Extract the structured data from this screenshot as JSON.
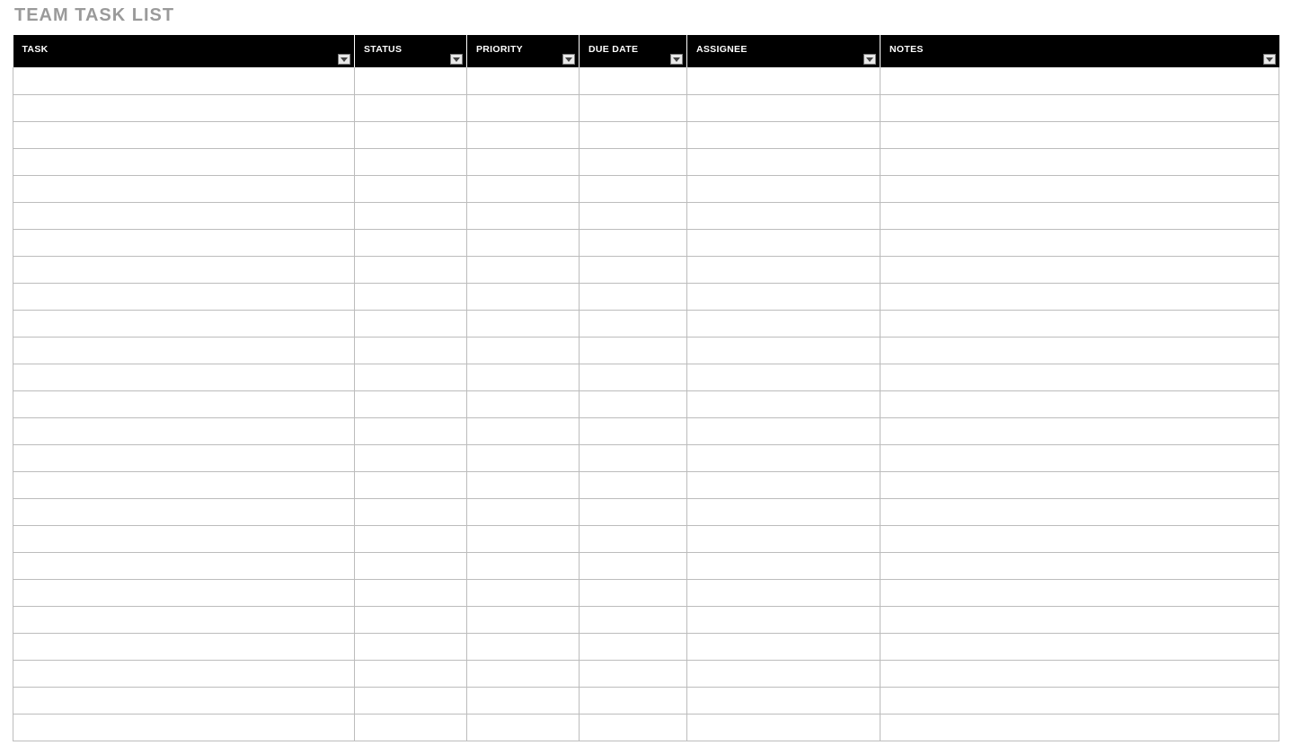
{
  "title": "TEAM TASK LIST",
  "columns": [
    {
      "key": "task",
      "label": "TASK",
      "filter": true
    },
    {
      "key": "status",
      "label": "STATUS",
      "filter": true
    },
    {
      "key": "priority",
      "label": "PRIORITY",
      "filter": true
    },
    {
      "key": "duedate",
      "label": "DUE DATE",
      "filter": true
    },
    {
      "key": "assignee",
      "label": "ASSIGNEE",
      "filter": true
    },
    {
      "key": "notes",
      "label": "NOTES",
      "filter": true
    }
  ],
  "rows": [
    {
      "task": "",
      "status": "",
      "priority": "",
      "duedate": "",
      "assignee": "",
      "notes": ""
    },
    {
      "task": "",
      "status": "",
      "priority": "",
      "duedate": "",
      "assignee": "",
      "notes": ""
    },
    {
      "task": "",
      "status": "",
      "priority": "",
      "duedate": "",
      "assignee": "",
      "notes": ""
    },
    {
      "task": "",
      "status": "",
      "priority": "",
      "duedate": "",
      "assignee": "",
      "notes": ""
    },
    {
      "task": "",
      "status": "",
      "priority": "",
      "duedate": "",
      "assignee": "",
      "notes": ""
    },
    {
      "task": "",
      "status": "",
      "priority": "",
      "duedate": "",
      "assignee": "",
      "notes": ""
    },
    {
      "task": "",
      "status": "",
      "priority": "",
      "duedate": "",
      "assignee": "",
      "notes": ""
    },
    {
      "task": "",
      "status": "",
      "priority": "",
      "duedate": "",
      "assignee": "",
      "notes": ""
    },
    {
      "task": "",
      "status": "",
      "priority": "",
      "duedate": "",
      "assignee": "",
      "notes": ""
    },
    {
      "task": "",
      "status": "",
      "priority": "",
      "duedate": "",
      "assignee": "",
      "notes": ""
    },
    {
      "task": "",
      "status": "",
      "priority": "",
      "duedate": "",
      "assignee": "",
      "notes": ""
    },
    {
      "task": "",
      "status": "",
      "priority": "",
      "duedate": "",
      "assignee": "",
      "notes": ""
    },
    {
      "task": "",
      "status": "",
      "priority": "",
      "duedate": "",
      "assignee": "",
      "notes": ""
    },
    {
      "task": "",
      "status": "",
      "priority": "",
      "duedate": "",
      "assignee": "",
      "notes": ""
    },
    {
      "task": "",
      "status": "",
      "priority": "",
      "duedate": "",
      "assignee": "",
      "notes": ""
    },
    {
      "task": "",
      "status": "",
      "priority": "",
      "duedate": "",
      "assignee": "",
      "notes": ""
    },
    {
      "task": "",
      "status": "",
      "priority": "",
      "duedate": "",
      "assignee": "",
      "notes": ""
    },
    {
      "task": "",
      "status": "",
      "priority": "",
      "duedate": "",
      "assignee": "",
      "notes": ""
    },
    {
      "task": "",
      "status": "",
      "priority": "",
      "duedate": "",
      "assignee": "",
      "notes": ""
    },
    {
      "task": "",
      "status": "",
      "priority": "",
      "duedate": "",
      "assignee": "",
      "notes": ""
    },
    {
      "task": "",
      "status": "",
      "priority": "",
      "duedate": "",
      "assignee": "",
      "notes": ""
    },
    {
      "task": "",
      "status": "",
      "priority": "",
      "duedate": "",
      "assignee": "",
      "notes": ""
    },
    {
      "task": "",
      "status": "",
      "priority": "",
      "duedate": "",
      "assignee": "",
      "notes": ""
    },
    {
      "task": "",
      "status": "",
      "priority": "",
      "duedate": "",
      "assignee": "",
      "notes": ""
    },
    {
      "task": "",
      "status": "",
      "priority": "",
      "duedate": "",
      "assignee": "",
      "notes": ""
    }
  ]
}
